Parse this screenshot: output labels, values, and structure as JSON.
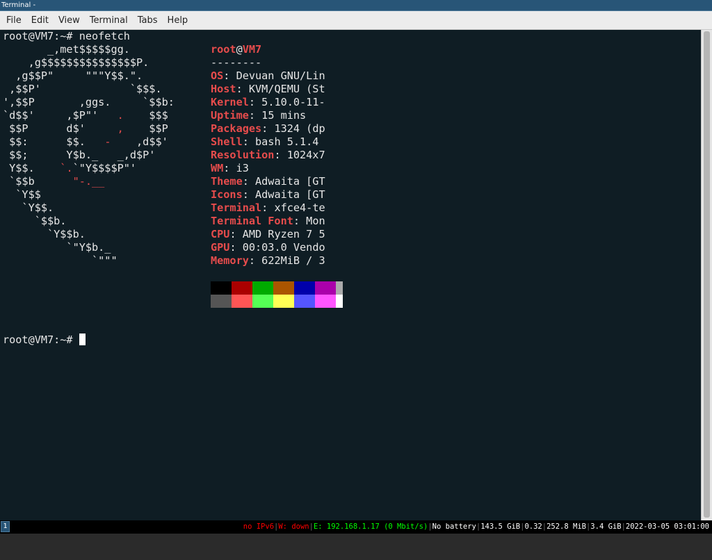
{
  "window": {
    "title": "Terminal -"
  },
  "menu": [
    "File",
    "Edit",
    "View",
    "Terminal",
    "Tabs",
    "Help"
  ],
  "terminal": {
    "command_prompt": "root@VM7:~# ",
    "command": "neofetch",
    "logo": [
      {
        "text": "       _,met$$$$$gg."
      },
      {
        "text": "    ,g$$$$$$$$$$$$$$$P."
      },
      {
        "text": "  ,g$$P\"     \"\"\"Y$$.\"."
      },
      {
        "text": " ,$$P'              `$$$."
      },
      {
        "text": "',$$P       ,ggs.     `$$b:"
      },
      {
        "pre": "`d$$'     ,$P\"'   ",
        "red": ".",
        "post": "    $$$"
      },
      {
        "pre": " $$P      d$'     ",
        "red": ",",
        "post": "    $$P"
      },
      {
        "pre": " $$:      $$.   ",
        "red": "-",
        "post": "    ,d$$'"
      },
      {
        "text": " $$;      Y$b._   _,d$P'"
      },
      {
        "pre": " Y$$.    ",
        "red": "`.",
        "post": "`\"Y$$$$P\"'"
      },
      {
        "pre": " `$$b      ",
        "red": "\"-.__",
        "post": ""
      },
      {
        "text": "  `Y$$"
      },
      {
        "text": "   `Y$$."
      },
      {
        "text": "     `$$b."
      },
      {
        "text": "       `Y$$b."
      },
      {
        "text": "          `\"Y$b._"
      },
      {
        "text": "              `\"\"\""
      }
    ],
    "info_user": "root",
    "info_at": "@",
    "info_host": "VM7",
    "info_divider": "--------",
    "info": [
      {
        "key": "OS",
        "value": "Devuan GNU/Lin"
      },
      {
        "key": "Host",
        "value": "KVM/QEMU (St"
      },
      {
        "key": "Kernel",
        "value": "5.10.0-11-"
      },
      {
        "key": "Uptime",
        "value": "15 mins"
      },
      {
        "key": "Packages",
        "value": "1324 (dp"
      },
      {
        "key": "Shell",
        "value": "bash 5.1.4"
      },
      {
        "key": "Resolution",
        "value": "1024x7"
      },
      {
        "key": "WM",
        "value": "i3"
      },
      {
        "key": "Theme",
        "value": "Adwaita [GT"
      },
      {
        "key": "Icons",
        "value": "Adwaita [GT"
      },
      {
        "key": "Terminal",
        "value": "xfce4-te"
      },
      {
        "key": "Terminal Font",
        "value": "Mon"
      },
      {
        "key": "CPU",
        "value": "AMD Ryzen 7 5"
      },
      {
        "key": "GPU",
        "value": "00:03.0 Vendo"
      },
      {
        "key": "Memory",
        "value": "622MiB / 3"
      }
    ],
    "palette_top": [
      "#000000",
      "#aa0000",
      "#00aa00",
      "#aa5500",
      "#0000aa",
      "#aa00aa",
      "#aaaaaa"
    ],
    "palette_bottom": [
      "#555555",
      "#ff5555",
      "#55ff55",
      "#ffff55",
      "#5555ff",
      "#ff55ff",
      "#ffffff"
    ],
    "final_prompt": "root@VM7:~# "
  },
  "statusbar": {
    "workspace": "1",
    "items": [
      {
        "text": "no IPv6",
        "state": "bad"
      },
      {
        "text": "W: down",
        "state": "bad"
      },
      {
        "text": "E: 192.168.1.17 (0 Mbit/s)",
        "state": "good"
      },
      {
        "text": "No battery",
        "state": "norm"
      },
      {
        "text": "143.5 GiB",
        "state": "norm"
      },
      {
        "text": "0.32",
        "state": "norm"
      },
      {
        "text": "252.8 MiB",
        "state": "norm"
      },
      {
        "text": "3.4 GiB",
        "state": "norm"
      },
      {
        "text": "2022-03-05 03:01:00",
        "state": "norm"
      }
    ]
  },
  "colors": {
    "terminal_bg": "#0f1d24",
    "accent_red": "#e74c4c",
    "titlebar": "#285577"
  }
}
